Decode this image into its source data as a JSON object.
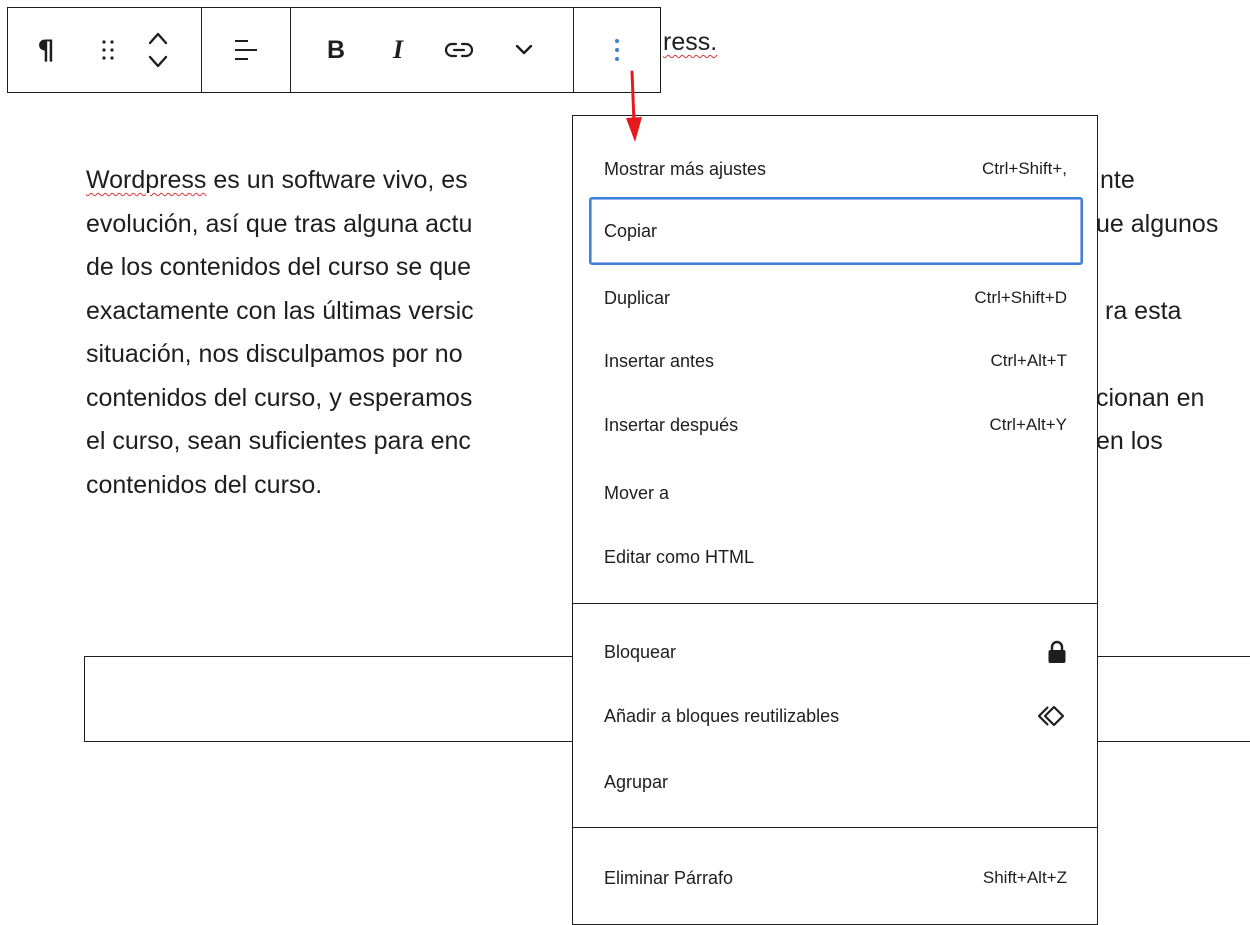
{
  "toolbar": {
    "buttons": [
      {
        "name": "paragraph",
        "glyph": "¶"
      },
      {
        "name": "drag"
      },
      {
        "name": "move-up-down"
      },
      {
        "name": "align"
      },
      {
        "name": "bold",
        "glyph": "B"
      },
      {
        "name": "italic",
        "glyph": "I"
      },
      {
        "name": "link"
      },
      {
        "name": "more-rich-text"
      },
      {
        "name": "options"
      }
    ]
  },
  "document": {
    "heading_tail": "ress.",
    "paragraph_lines": [
      {
        "pre": "",
        "spell": "Wordpress",
        "post": " es un software vivo, es",
        "tail": "nte"
      },
      {
        "pre": "evolución, así que tras alguna actu",
        "tail": "ue algunos"
      },
      {
        "pre": "de los contenidos del curso se que",
        "tail": ""
      },
      {
        "pre": "exactamente con las últimas versic",
        "tail": "ra esta"
      },
      {
        "pre": "situación, nos disculpamos por no",
        "tail": ""
      },
      {
        "pre": "contenidos del curso, y esperamos",
        "tail": "cionan en"
      },
      {
        "pre": "el curso, sean suficientes para enc",
        "tail": "en los"
      },
      {
        "pre": "contenidos del curso.",
        "tail": ""
      }
    ]
  },
  "menu": {
    "section1": [
      {
        "label": "Mostrar más ajustes",
        "shortcut": "Ctrl+Shift+,"
      },
      {
        "label": "Copiar",
        "shortcut": "",
        "focused": true
      },
      {
        "label": "Duplicar",
        "shortcut": "Ctrl+Shift+D"
      },
      {
        "label": "Insertar antes",
        "shortcut": "Ctrl+Alt+T"
      },
      {
        "label": "Insertar después",
        "shortcut": "Ctrl+Alt+Y"
      },
      {
        "label": "Mover a",
        "shortcut": ""
      },
      {
        "label": "Editar como HTML",
        "shortcut": ""
      }
    ],
    "section2": [
      {
        "label": "Bloquear",
        "icon": "lock-icon"
      },
      {
        "label": "Añadir a bloques reutilizables",
        "icon": "reusable-block-icon"
      },
      {
        "label": "Agrupar",
        "icon": ""
      }
    ],
    "section3": [
      {
        "label": "Eliminar Párrafo",
        "shortcut": "Shift+Alt+Z"
      }
    ]
  },
  "colors": {
    "accent_focus": "#3b82d6",
    "options_icon": "#3858e9",
    "annotation_arrow": "#e8191c",
    "spellcheck": "#d63638"
  }
}
